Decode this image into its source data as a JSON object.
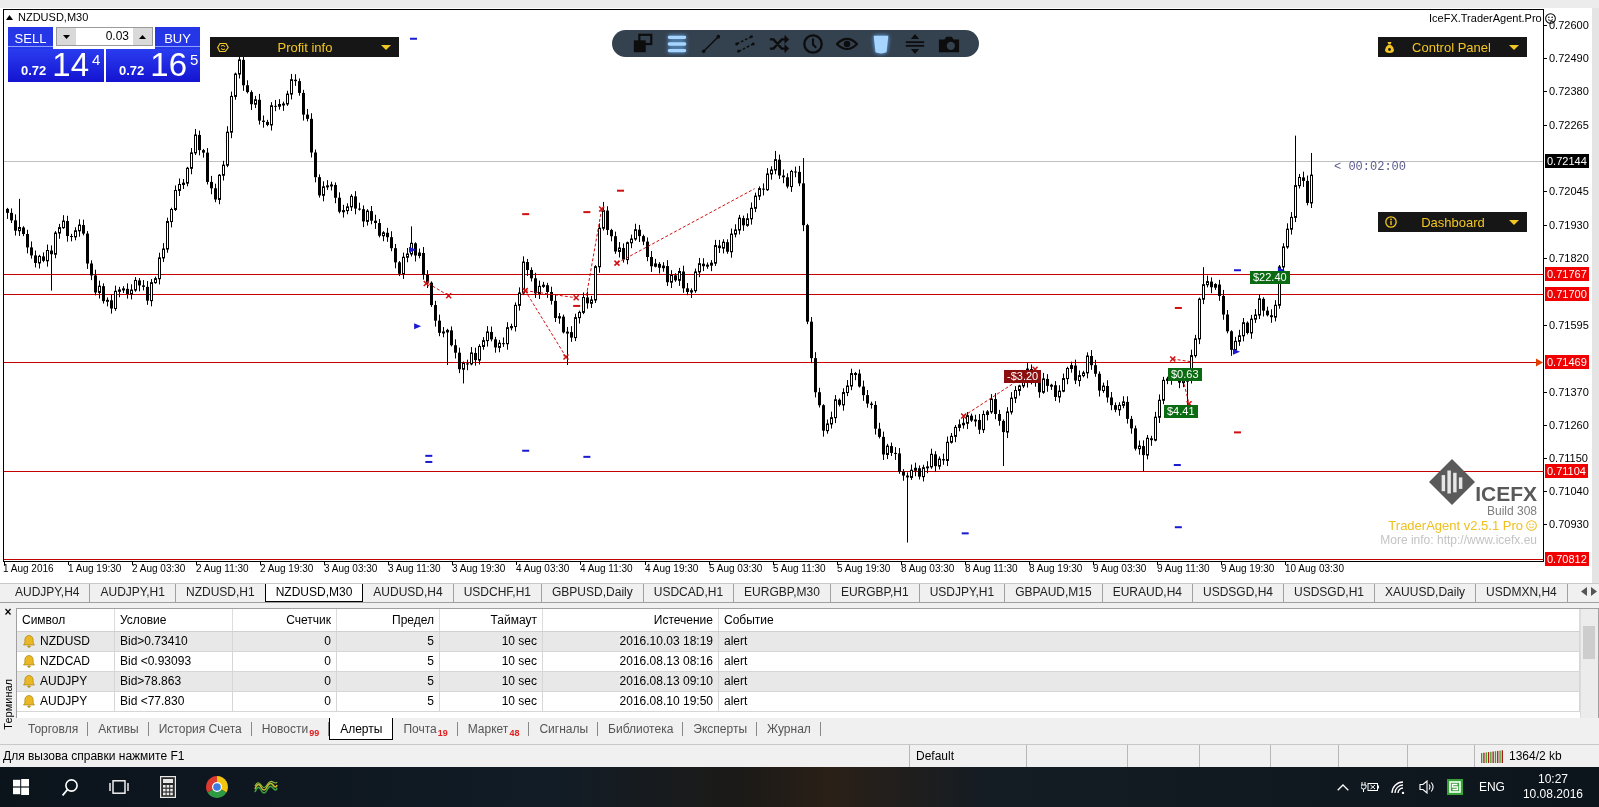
{
  "chart": {
    "title": "NZDUSD,M30",
    "trade_panel": {
      "sell": "SELL",
      "buy": "BUY",
      "lot": "0.03",
      "sell_price": [
        "0.72",
        "14",
        "4"
      ],
      "buy_price": [
        "0.72",
        "16",
        "5"
      ]
    },
    "profit_info": {
      "label": "Profit info"
    },
    "toolbar": [
      {
        "kind": "windows",
        "selected": false
      },
      {
        "kind": "list",
        "selected": true
      },
      {
        "kind": "line",
        "selected": false
      },
      {
        "kind": "channel",
        "selected": false
      },
      {
        "kind": "shuffle",
        "selected": false
      },
      {
        "kind": "clock",
        "selected": false
      },
      {
        "kind": "eye",
        "selected": false
      },
      {
        "kind": "trash",
        "selected": true
      },
      {
        "kind": "split",
        "selected": false
      },
      {
        "kind": "camera",
        "selected": false
      }
    ],
    "brand": "IceFX.TraderAgent.Pro",
    "control_panel": {
      "label": "Control Panel"
    },
    "countdown": "< 00:02:00",
    "dashboard": {
      "label": "Dashboard"
    },
    "price_ticks": [
      "0.72600",
      "0.72490",
      "0.72380",
      "0.72265",
      "0.72045",
      "0.71930",
      "0.71820",
      "0.71595",
      "0.71370",
      "0.71260",
      "0.71150",
      "0.71040",
      "0.70930"
    ],
    "current_price": "0.72144",
    "levels": [
      {
        "price": "0.71767",
        "kind": "plain"
      },
      {
        "price": "0.71700",
        "kind": "plain"
      },
      {
        "price": "0.71469",
        "kind": "arrow"
      },
      {
        "price": "0.71104",
        "kind": "plain"
      },
      {
        "price": "0.70812",
        "kind": "plain"
      }
    ],
    "trade_labels": [
      {
        "text": "-$3.20",
        "color": "#8b0f0f"
      },
      {
        "text": "$0.63",
        "color": "#0b6b12"
      },
      {
        "text": "$4.41",
        "color": "#0b6b12"
      },
      {
        "text": "$22.40",
        "color": "#0b6b12"
      }
    ],
    "logo": {
      "name": "ICEFX",
      "build": "Build 308",
      "product": "TraderAgent v2.5.1 Pro",
      "more_info": "More info: http://www.icefx.eu"
    },
    "time_axis": [
      "1 Aug 2016",
      "1 Aug 19:30",
      "2 Aug 03:30",
      "2 Aug 11:30",
      "2 Aug 19:30",
      "3 Aug 03:30",
      "3 Aug 11:30",
      "3 Aug 19:30",
      "4 Aug 03:30",
      "4 Aug 11:30",
      "4 Aug 19:30",
      "5 Aug 03:30",
      "5 Aug 11:30",
      "5 Aug 19:30",
      "8 Aug 03:30",
      "8 Aug 11:30",
      "8 Aug 19:30",
      "9 Aug 03:30",
      "9 Aug 11:30",
      "9 Aug 19:30",
      "10 Aug 03:30"
    ]
  },
  "chart_tabs": [
    {
      "label": "AUDJPY,H4",
      "selected": false
    },
    {
      "label": "AUDJPY,H1",
      "selected": false
    },
    {
      "label": "NZDUSD,H1",
      "selected": false
    },
    {
      "label": "NZDUSD,M30",
      "selected": true
    },
    {
      "label": "AUDUSD,H4",
      "selected": false
    },
    {
      "label": "USDCHF,H1",
      "selected": false
    },
    {
      "label": "GBPUSD,Daily",
      "selected": false
    },
    {
      "label": "USDCAD,H1",
      "selected": false
    },
    {
      "label": "EURGBP,M30",
      "selected": false
    },
    {
      "label": "EURGBP,H1",
      "selected": false
    },
    {
      "label": "USDJPY,H1",
      "selected": false
    },
    {
      "label": "GBPAUD,M15",
      "selected": false
    },
    {
      "label": "EURAUD,H4",
      "selected": false
    },
    {
      "label": "USDSGD,H4",
      "selected": false
    },
    {
      "label": "USDSGD,H1",
      "selected": false
    },
    {
      "label": "XAUUSD,Daily",
      "selected": false
    },
    {
      "label": "USDMXN,H4",
      "selected": false
    }
  ],
  "terminal": {
    "title": "Терминал",
    "close": "×",
    "columns": [
      "Символ",
      "Условие",
      "Счетчик",
      "Предел",
      "Таймаут",
      "Истечение",
      "Событие"
    ],
    "rows": [
      {
        "cells": [
          "NZDUSD",
          "Bid>0.73410",
          "0",
          "5",
          "10 sec",
          "2016.10.03 18:19",
          "alert"
        ]
      },
      {
        "cells": [
          "NZDCAD",
          "Bid <0.93093",
          "0",
          "5",
          "10 sec",
          "2016.08.13 08:16",
          "alert"
        ]
      },
      {
        "cells": [
          "AUDJPY",
          "Bid>78.863",
          "0",
          "5",
          "10 sec",
          "2016.08.13 09:10",
          "alert"
        ]
      },
      {
        "cells": [
          "AUDJPY",
          "Bid <77.830",
          "0",
          "5",
          "10 sec",
          "2016.08.10 19:50",
          "alert"
        ]
      }
    ],
    "tabs": [
      {
        "label": "Торговля",
        "selected": false
      },
      {
        "label": "Активы",
        "selected": false
      },
      {
        "label": "История Счета",
        "selected": false
      },
      {
        "label": "Новости",
        "badge": "99",
        "selected": false
      },
      {
        "label": "Алерты",
        "selected": true
      },
      {
        "label": "Почта",
        "badge": "19",
        "selected": false
      },
      {
        "label": "Маркет",
        "badge": "48",
        "selected": false
      },
      {
        "label": "Сигналы",
        "selected": false
      },
      {
        "label": "Библиотека",
        "selected": false
      },
      {
        "label": "Эксперты",
        "selected": false
      },
      {
        "label": "Журнал",
        "selected": false
      }
    ]
  },
  "status_bar": {
    "help": "Для вызова справки нажмите F1",
    "profile": "Default",
    "traffic": "1364/2 kb"
  },
  "taskbar": {
    "language": "ENG",
    "time": "10:27",
    "date": "10.08.2016"
  }
}
